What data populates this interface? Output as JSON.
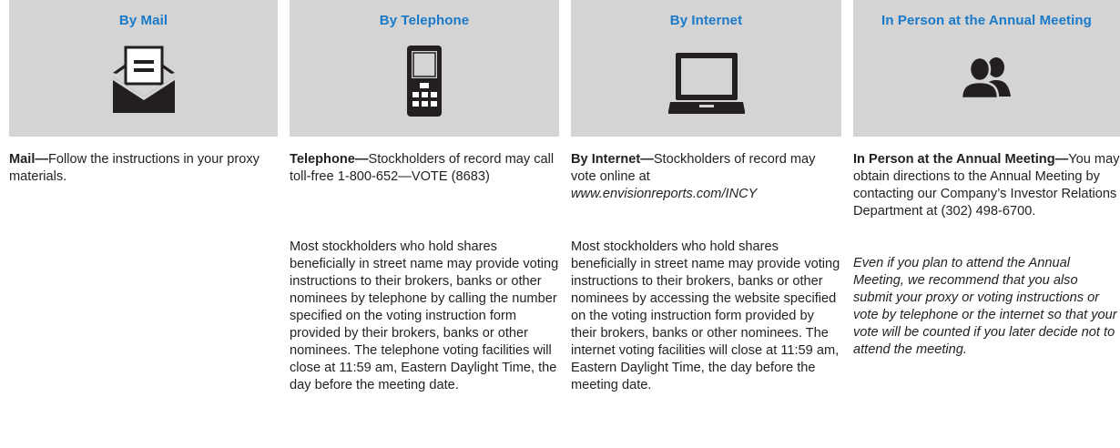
{
  "columns": [
    {
      "id": "mail",
      "title": "By Mail",
      "icon": "envelope-icon",
      "p1_lead": "Mail—",
      "p1_text": "Follow the instructions in your proxy materials.",
      "p2_text": ""
    },
    {
      "id": "telephone",
      "title": "By Telephone",
      "icon": "phone-icon",
      "p1_lead": "Telephone—",
      "p1_text": "Stockholders of record may call toll-free 1-800-652—VOTE (8683)",
      "p2_text": "Most stockholders who hold shares beneficially in street name may provide voting instructions to their brokers, banks or other nominees by telephone by calling the number specified on the voting instruction form provided by their brokers, banks or other nominees. The telephone voting facilities will close at 11:59 am, Eastern Daylight Time, the day before the meeting date."
    },
    {
      "id": "internet",
      "title": "By Internet",
      "icon": "laptop-icon",
      "p1_lead": "By Internet—",
      "p1_text": "Stockholders of record may vote online at",
      "p1_url": "www.envisionreports.com/INCY",
      "p2_text": "Most stockholders who hold shares beneficially in street name may provide voting instructions to their brokers, banks or other nominees by accessing the website specified on the voting instruction form provided by their brokers, banks or other nominees. The internet voting facilities will close at 11:59 am, Eastern Daylight Time, the day before the meeting date."
    },
    {
      "id": "in_person",
      "title": "In Person at the Annual Meeting",
      "icon": "people-icon",
      "p1_lead": "In Person at the Annual Meeting—",
      "p1_text": "You may obtain directions to the Annual Meeting by contacting our Company’s Investor Relations Department at (302) 498-6700.",
      "p2_text": "Even if you plan to attend the Annual Meeting, we recommend that you also submit your proxy or voting instructions or vote by telephone or the internet so that your vote will be counted if you later decide not to attend the meeting."
    }
  ],
  "colors": {
    "header_bg": "#d4d4d4",
    "title_blue": "#1a7ac9",
    "icon_black": "#231f20",
    "text": "#231f20"
  }
}
